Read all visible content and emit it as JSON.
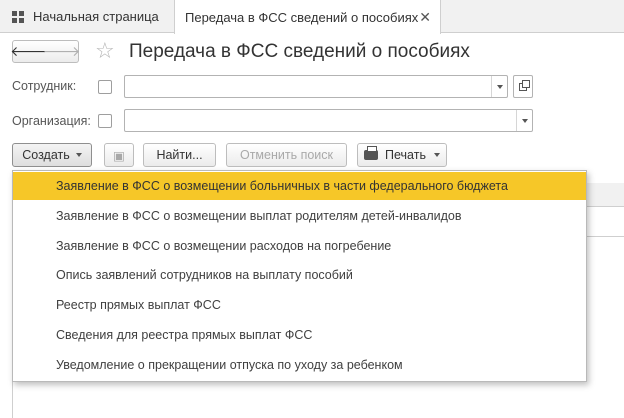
{
  "tabs": {
    "home_label": "Начальная страница",
    "active_label": "Передача в ФСС сведений о пособиях"
  },
  "page": {
    "title": "Передача в ФСС сведений о пособиях"
  },
  "filters": {
    "employee_label": "Сотрудник:",
    "employee_value": "",
    "organization_label": "Организация:",
    "organization_value": ""
  },
  "toolbar": {
    "create_label": "Создать",
    "find_label": "Найти...",
    "cancel_search_label": "Отменить поиск",
    "print_label": "Печать"
  },
  "create_menu": {
    "items": [
      "Заявление в ФСС о возмещении больничных в части федерального бюджета",
      "Заявление в ФСС о возмещении выплат родителям детей-инвалидов",
      "Заявление в ФСС о возмещении расходов на погребение",
      "Опись заявлений сотрудников на выплату пособий",
      "Реестр прямых выплат ФСС",
      "Сведения для реестра прямых выплат ФСС",
      "Уведомление о прекращении отпуска по уходу за ребенком"
    ],
    "highlighted_index": 0,
    "highlight_color": "#f6c728"
  },
  "icons": {
    "home": "grid-icon",
    "close": "close-icon",
    "back": "arrow-left-icon",
    "forward": "arrow-right-icon",
    "favorite": "star-icon",
    "open": "open-form-icon",
    "dropdown": "chevron-down-icon",
    "print": "printer-icon"
  }
}
